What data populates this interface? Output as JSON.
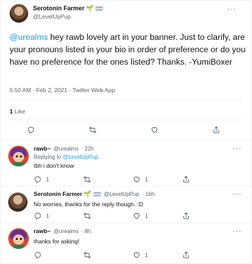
{
  "main": {
    "author_name": "Serotonin Farmer",
    "author_emoji": "🌱",
    "author_handle": "@LevelUpPup",
    "more_label": "···",
    "mention": "@urealms",
    "text": " hey rawb lovely art in your banner. Just to clarify, are your pronouns listed in your bio in order of preference or do you have no preference for the ones listed? Thanks. -YumiBoxer",
    "meta": "5:50 AM · Feb 2, 2021 · Twitter Web App",
    "likes_count": "1",
    "likes_label": " Like"
  },
  "replies": [
    {
      "name": "rawb~",
      "handle": "@urealms",
      "time": "· 22h",
      "replying_prefix": "Replying to ",
      "replying_to": "@LevelUpPup",
      "text": "tbh i don't know",
      "reply_count": "1",
      "retweet_count": "",
      "like_count": "1"
    },
    {
      "name": "Serotonin Farmer",
      "emoji": "🌱",
      "handle": "@LevelUpPup",
      "time": "· 16h",
      "text": "No worries, thanks for the reply though. :D",
      "reply_count": "1",
      "retweet_count": "",
      "like_count": "1"
    },
    {
      "name": "rawb~",
      "handle": "@urealms",
      "time": "· 8h",
      "text": "thanks for asking!",
      "reply_count": "",
      "retweet_count": "",
      "like_count": "1"
    }
  ],
  "colors": {
    "accent": "#1d9bf0",
    "secondary_text": "#536471",
    "divider": "#eff3f4"
  },
  "icons": [
    "reply-icon",
    "retweet-icon",
    "like-icon",
    "share-icon",
    "more-icon"
  ]
}
